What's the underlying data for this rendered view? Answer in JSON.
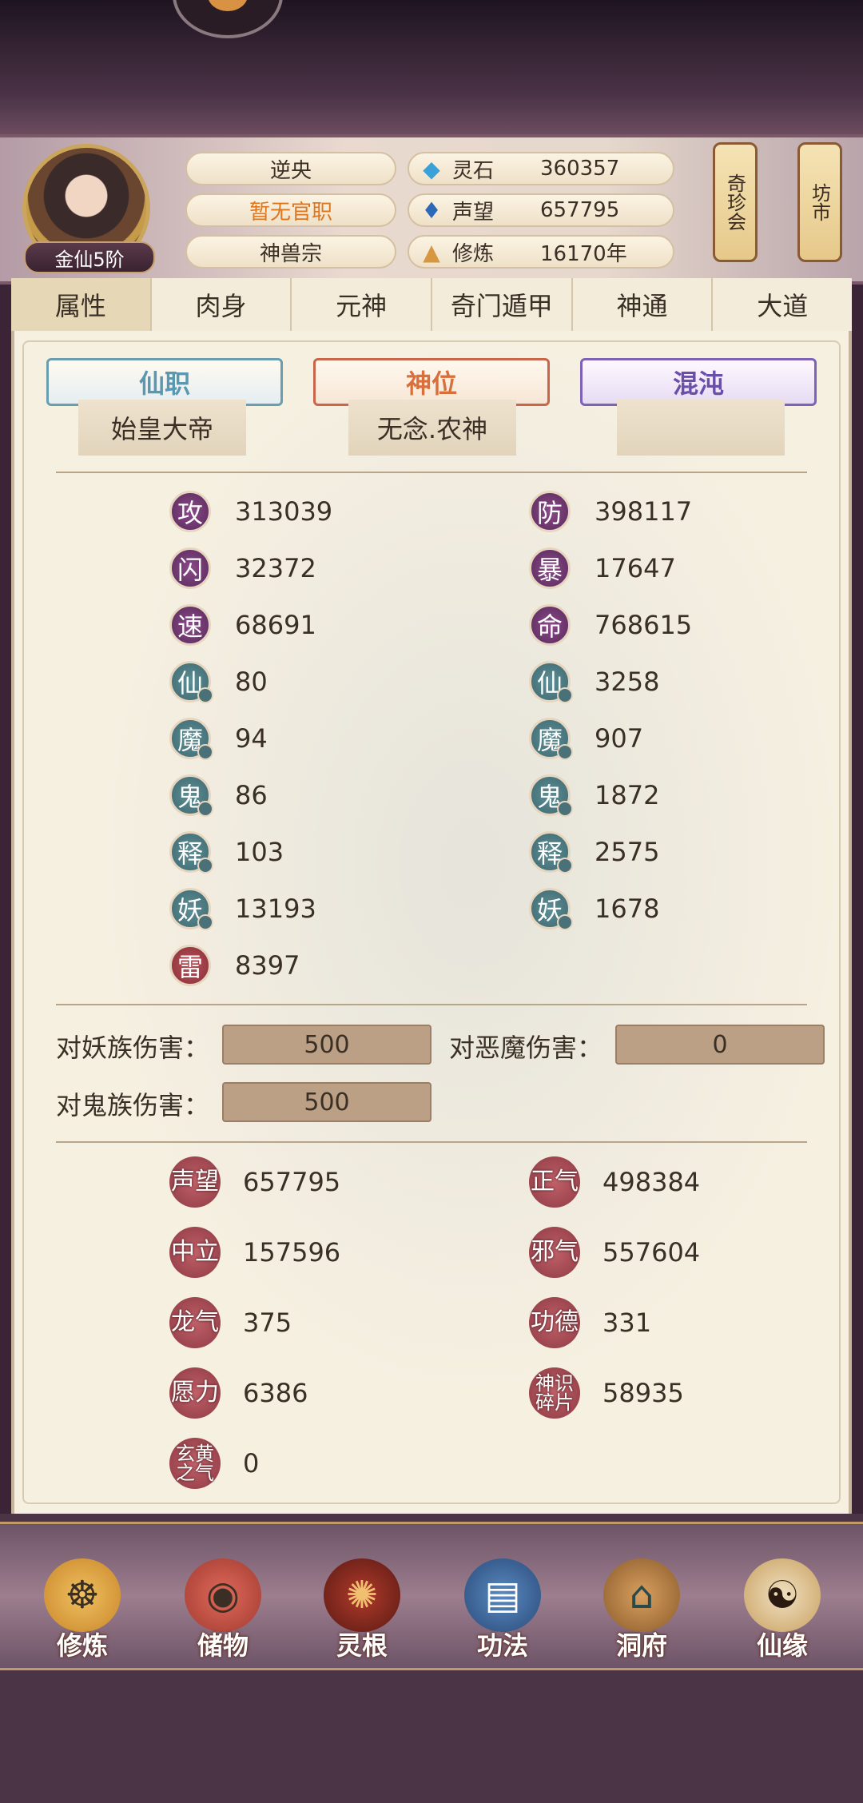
{
  "header": {
    "name": "逆央",
    "title": "暂无官职",
    "sect": "神兽宗",
    "rank": "金仙5阶",
    "resources": [
      {
        "icon": "gem-icon",
        "label": "灵石",
        "value": "360357"
      },
      {
        "icon": "flame-icon",
        "label": "声望",
        "value": "657795"
      },
      {
        "icon": "meditation-icon",
        "label": "修炼",
        "value": "16170年"
      }
    ],
    "scrolls": [
      "奇珍会",
      "坊市"
    ]
  },
  "tabs": [
    "属性",
    "肉身",
    "元神",
    "奇门遁甲",
    "神通",
    "大道"
  ],
  "positions": [
    {
      "banner": "仙职",
      "value": "始皇大帝"
    },
    {
      "banner": "神位",
      "value": "无念.农神"
    },
    {
      "banner": "混沌",
      "value": ""
    }
  ],
  "stats_left": [
    {
      "icon": "攻",
      "value": "313039"
    },
    {
      "icon": "闪",
      "value": "32372"
    },
    {
      "icon": "速",
      "value": "68691"
    },
    {
      "icon": "仙",
      "value": "80"
    },
    {
      "icon": "魔",
      "value": "94"
    },
    {
      "icon": "鬼",
      "value": "86"
    },
    {
      "icon": "释",
      "value": "103"
    },
    {
      "icon": "妖",
      "value": "13193"
    },
    {
      "icon": "雷",
      "value": "8397"
    }
  ],
  "stats_right": [
    {
      "icon": "防",
      "value": "398117"
    },
    {
      "icon": "暴",
      "value": "17647"
    },
    {
      "icon": "命",
      "value": "768615"
    },
    {
      "icon": "仙",
      "value": "3258"
    },
    {
      "icon": "魔",
      "value": "907"
    },
    {
      "icon": "鬼",
      "value": "1872"
    },
    {
      "icon": "释",
      "value": "2575"
    },
    {
      "icon": "妖",
      "value": "1678"
    }
  ],
  "damage": [
    {
      "label": "对妖族伤害：",
      "value": "500"
    },
    {
      "label": "对恶魔伤害：",
      "value": "0"
    },
    {
      "label": "对鬼族伤害：",
      "value": "500"
    }
  ],
  "reputation_left": [
    {
      "icon": "声望",
      "value": "657795"
    },
    {
      "icon": "中立",
      "value": "157596"
    },
    {
      "icon": "龙气",
      "value": "375"
    },
    {
      "icon": "愿力",
      "value": "6386"
    },
    {
      "icon": "玄黄之气",
      "value": "0"
    }
  ],
  "reputation_right": [
    {
      "icon": "正气",
      "value": "498384"
    },
    {
      "icon": "邪气",
      "value": "557604"
    },
    {
      "icon": "功德",
      "value": "331"
    },
    {
      "icon": "神识碎片",
      "value": "58935"
    }
  ],
  "nav": [
    "修炼",
    "储物",
    "灵根",
    "功法",
    "洞府",
    "仙缘"
  ]
}
